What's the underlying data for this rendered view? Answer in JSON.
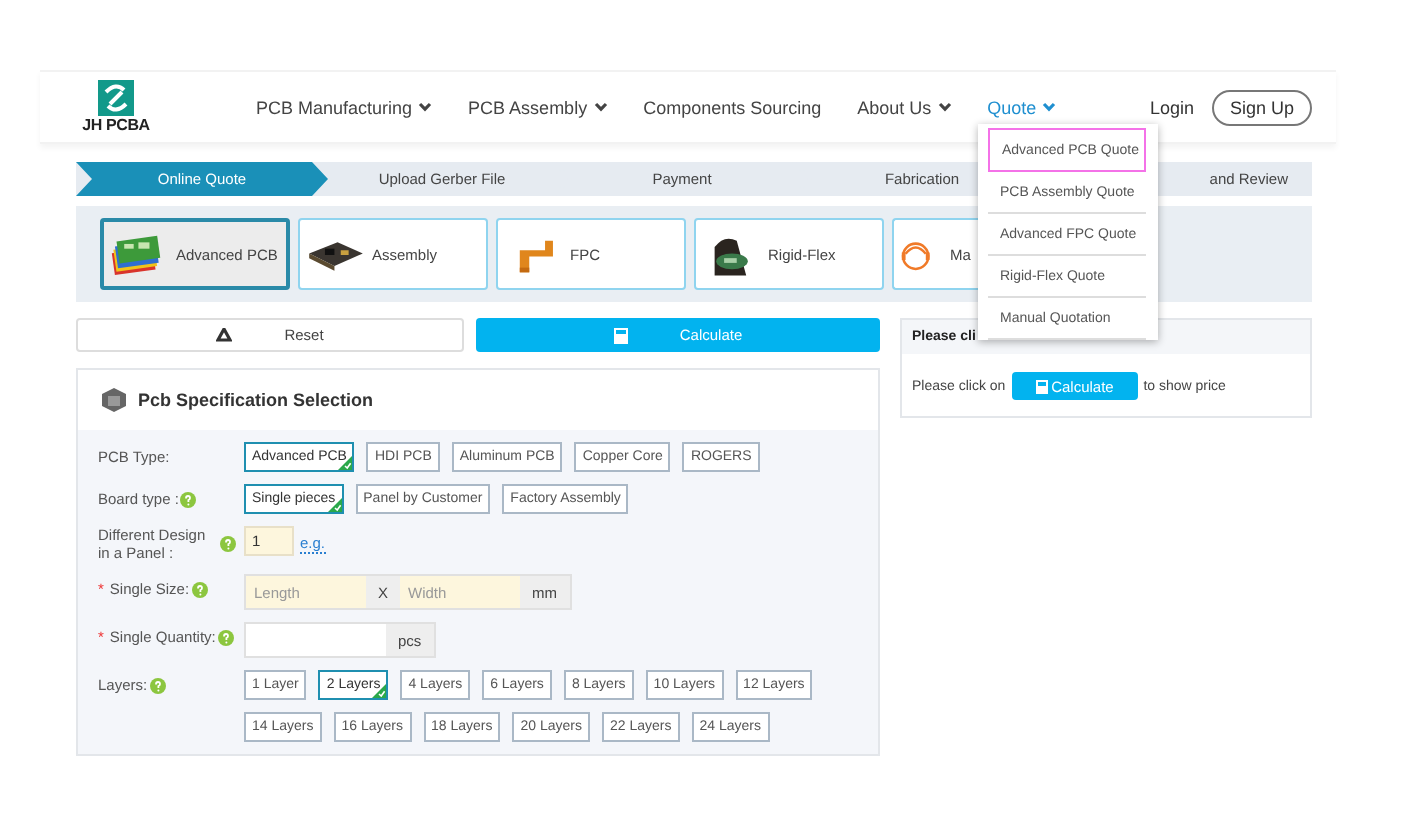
{
  "header": {
    "logo": "JH PCBA",
    "nav": [
      {
        "label": "PCB Manufacturing",
        "dropdown": true,
        "selected": false
      },
      {
        "label": "PCB Assembly",
        "dropdown": true,
        "selected": false
      },
      {
        "label": "Components Sourcing",
        "dropdown": false,
        "selected": false
      },
      {
        "label": "About Us",
        "dropdown": true,
        "selected": false
      },
      {
        "label": "Quote",
        "dropdown": true,
        "selected": true
      }
    ],
    "login": "Login",
    "signup": "Sign Up"
  },
  "steps": [
    {
      "label": "Online Quote",
      "selected": true
    },
    {
      "label": "Upload Gerber File",
      "selected": false
    },
    {
      "label": "Payment",
      "selected": false
    },
    {
      "label": "Fabrication",
      "selected": false
    },
    {
      "label": "and Review",
      "selected": false
    }
  ],
  "products": [
    {
      "label": "Advanced PCB",
      "kind": "pcb",
      "selected": true
    },
    {
      "label": "Assembly",
      "kind": "assembly",
      "selected": false
    },
    {
      "label": "FPC",
      "kind": "fpc",
      "selected": false
    },
    {
      "label": "Rigid-Flex",
      "kind": "rigidflex",
      "selected": false
    },
    {
      "label": "Ma",
      "kind": "manual",
      "selected": false
    }
  ],
  "actions": {
    "reset": "Reset",
    "calculate": "Calculate"
  },
  "spec": {
    "title": "Pcb Specification Selection",
    "rows": [
      {
        "kind": "options",
        "label": "PCB Type:",
        "help": false,
        "options": [
          {
            "label": "Advanced PCB",
            "selected": true
          },
          {
            "label": "HDI PCB",
            "selected": false
          },
          {
            "label": "Aluminum PCB",
            "selected": false
          },
          {
            "label": "Copper Core",
            "selected": false
          },
          {
            "label": "ROGERS",
            "selected": false
          }
        ]
      },
      {
        "kind": "options",
        "label": "Board type :",
        "help": true,
        "options": [
          {
            "label": "Single pieces",
            "selected": true
          },
          {
            "label": "Panel by Customer",
            "selected": false
          },
          {
            "label": "Factory Assembly",
            "selected": false
          }
        ]
      },
      {
        "kind": "number",
        "label": "Different Design in a Panel :",
        "help": true,
        "value": "1",
        "link": "e.g."
      },
      {
        "kind": "size",
        "label": "Single Size:",
        "marker": "*",
        "help": true,
        "length_placeholder": "Length",
        "separator": "X",
        "width_placeholder": "Width",
        "unit": "mm"
      },
      {
        "kind": "quantity",
        "label": "Single Quantity:",
        "marker": "*",
        "help": true,
        "unit": "pcs"
      },
      {
        "kind": "options",
        "label": "Layers:",
        "help": true,
        "options": [
          {
            "label": "1 Layer",
            "selected": false
          },
          {
            "label": "2 Layers",
            "selected": true
          },
          {
            "label": "4 Layers",
            "selected": false
          },
          {
            "label": "6 Layers",
            "selected": false
          },
          {
            "label": "8 Layers",
            "selected": false
          },
          {
            "label": "10 Layers",
            "selected": false
          },
          {
            "label": "12 Layers",
            "selected": false
          },
          {
            "label": "14 Layers",
            "selected": false
          },
          {
            "label": "16 Layers",
            "selected": false
          },
          {
            "label": "18 Layers",
            "selected": false
          },
          {
            "label": "20 Layers",
            "selected": false
          },
          {
            "label": "22 Layers",
            "selected": false
          },
          {
            "label": "24 Layers",
            "selected": false
          }
        ]
      }
    ]
  },
  "price": {
    "title": "Please cli",
    "before": "Please click on",
    "button": "Calculate",
    "after": "to show price"
  },
  "dropdown": [
    {
      "label": "Advanced PCB Quote",
      "selected": true
    },
    {
      "label": "PCB Assembly Quote",
      "selected": false
    },
    {
      "label": "Advanced FPC Quote",
      "selected": false
    },
    {
      "label": "Rigid-Flex Quote",
      "selected": false
    },
    {
      "label": "Manual Quotation",
      "selected": false
    }
  ]
}
